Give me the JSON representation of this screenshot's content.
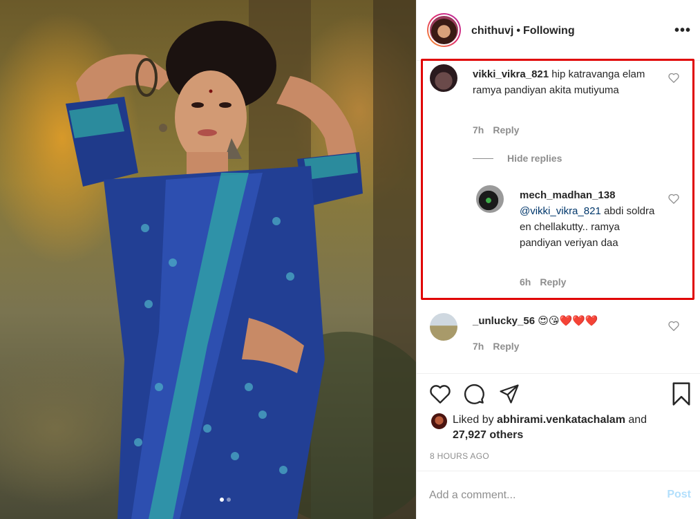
{
  "header": {
    "username": "chithuvj",
    "separator": "•",
    "follow_status": "Following",
    "more_icon": "more-horizontal-icon",
    "more_glyph": "•••"
  },
  "comments": [
    {
      "username": "vikki_vikra_821",
      "text": "hip katravanga elam ramya pandiyan akita mutiyuma",
      "time": "7h",
      "reply_label": "Reply",
      "hide_replies_label": "Hide replies",
      "replies": [
        {
          "username": "mech_madhan_138",
          "mention": "@vikki_vikra_821",
          "text": "abdi soldra en chellakutty.. ramya pandiyan veriyan daa",
          "time": "6h",
          "reply_label": "Reply"
        }
      ]
    },
    {
      "username": "_unlucky_56",
      "text": "😍😘❤️❤️❤️",
      "time": "7h",
      "reply_label": "Reply"
    }
  ],
  "actions": {
    "like_icon": "heart-icon",
    "comment_icon": "comment-bubble-icon",
    "share_icon": "paper-plane-icon",
    "save_icon": "bookmark-icon"
  },
  "likes": {
    "prefix": "Liked by",
    "user": "abhirami.venkatachalam",
    "conjunction": "and",
    "others": "27,927 others"
  },
  "timestamp": "8 HOURS AGO",
  "add_comment": {
    "placeholder": "Add a comment...",
    "post_label": "Post"
  },
  "colors": {
    "highlight_border": "#e00000",
    "post_disabled": "#b2dffc",
    "meta_gray": "#8e8e8e",
    "mention_blue": "#00376b"
  },
  "carousel": {
    "total": 2,
    "active": 1
  }
}
